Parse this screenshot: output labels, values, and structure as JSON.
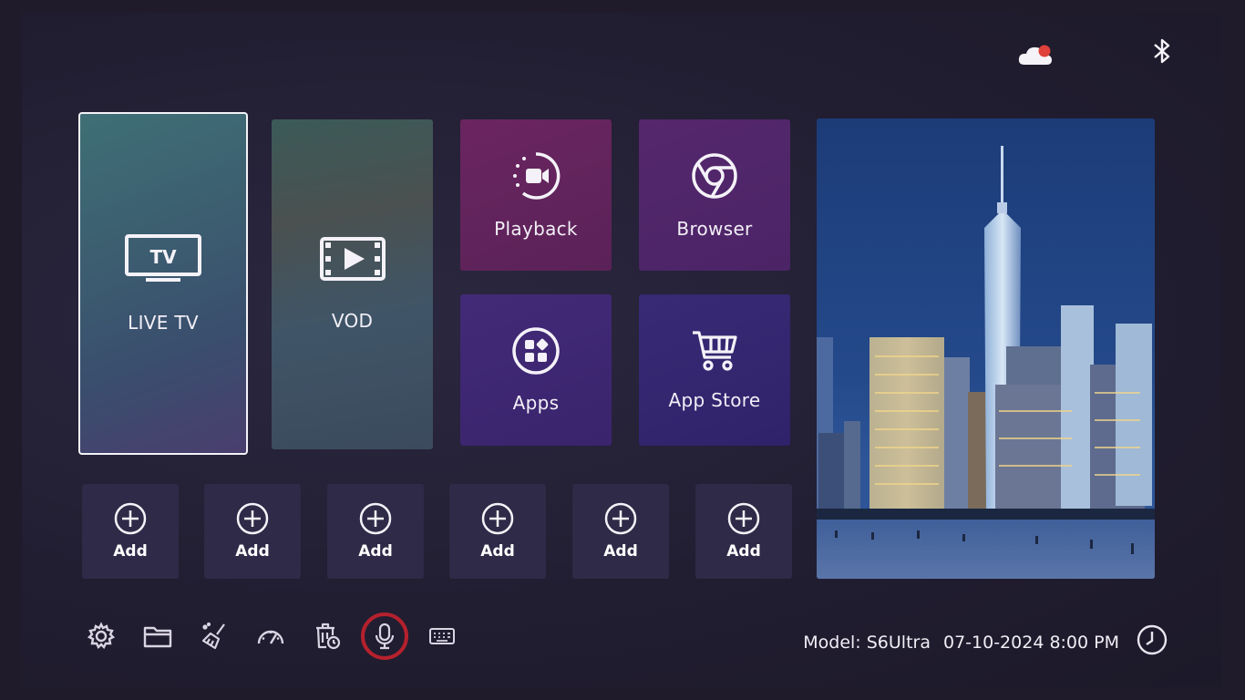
{
  "tiles": {
    "live_tv": "LIVE TV",
    "vod": "VOD",
    "playback": "Playback",
    "browser": "Browser",
    "apps": "Apps",
    "app_store": "App Store"
  },
  "shortcuts": [
    {
      "label": "Add"
    },
    {
      "label": "Add"
    },
    {
      "label": "Add"
    },
    {
      "label": "Add"
    },
    {
      "label": "Add"
    },
    {
      "label": "Add"
    }
  ],
  "tv_icon_text": "TV",
  "status": {
    "model": "Model: S6Ultra",
    "datetime": "07-10-2024 8:00 PM"
  },
  "toolbar_icons": [
    "settings-icon",
    "folder-icon",
    "clean-icon",
    "speed-icon",
    "uninstall-icon",
    "microphone-icon",
    "keyboard-icon"
  ],
  "colors": {
    "focus_ring": "#b5212d",
    "cloud_alert": "#e0403a",
    "playback_tile": "#6b2560",
    "browser_tile": "#55276d",
    "apps_tile": "#432a78",
    "store_tile": "#382a75"
  }
}
